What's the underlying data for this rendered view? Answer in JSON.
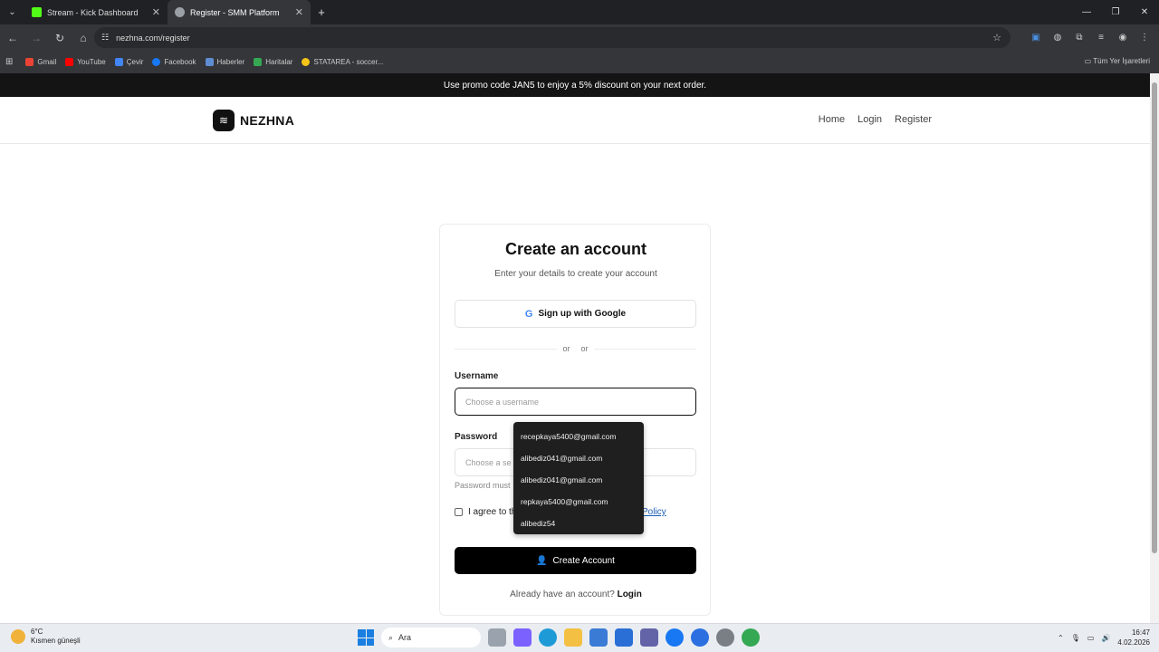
{
  "browser": {
    "tabs": [
      {
        "title": "Stream - Kick Dashboard",
        "favicon_color": "#53fc18"
      },
      {
        "title": "Register - SMM Platform",
        "favicon_color": "#9aa0a6"
      }
    ],
    "url": "nezhna.com/register",
    "bookmarks": [
      {
        "label": "Gmail",
        "color": "#ea4335"
      },
      {
        "label": "YouTube",
        "color": "#ff0000"
      },
      {
        "label": "Çevir",
        "color": "#4285f4"
      },
      {
        "label": "Facebook",
        "color": "#1877f2"
      },
      {
        "label": "Haberler",
        "color": "#5f8dd3"
      },
      {
        "label": "Haritalar",
        "color": "#34a853"
      },
      {
        "label": "STATAREA - soccer...",
        "color": "#f5c518"
      }
    ],
    "all_bookmarks": "Tüm Yer İşaretleri"
  },
  "promo": "Use promo code JAN5 to enjoy a 5% discount on your next order.",
  "header": {
    "brand": "NEZHNA",
    "nav": [
      "Home",
      "Login",
      "Register"
    ]
  },
  "form": {
    "title": "Create an account",
    "subtitle": "Enter your details to create your account",
    "google_button": "Sign up with Google",
    "divider_text": "or",
    "username_label": "Username",
    "username_placeholder": "Choose a username",
    "password_label": "Password",
    "password_placeholder": "Choose a se",
    "password_hint": "Password must",
    "agree_text": "I agree to th",
    "policy_text": "Policy",
    "submit": "Create Account",
    "already": "Already have an account?",
    "login_link": "Login"
  },
  "autocomplete": [
    "recepkaya5400@gmail.com",
    "alibediz041@gmail.com",
    "alibediz041@gmail.com",
    "repkaya5400@gmail.com",
    "alibediz54"
  ],
  "taskbar": {
    "weather_temp": "6°C",
    "weather_desc": "Kısmen güneşli",
    "search": "Ara",
    "time": "16:47",
    "date": "4.02.2026"
  }
}
